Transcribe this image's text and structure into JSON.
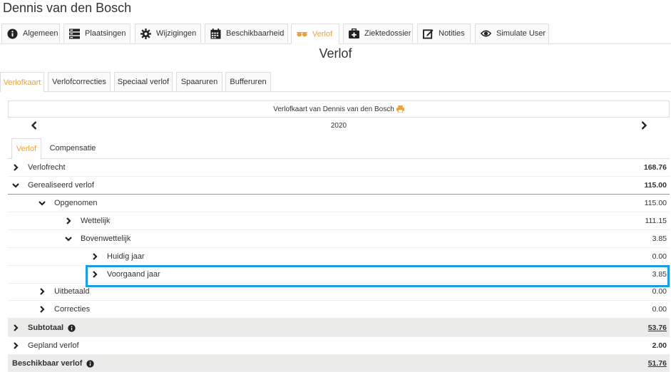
{
  "page": {
    "title": "Dennis van den Bosch",
    "section_title": "Verlof"
  },
  "main_tabs": [
    {
      "label": "Algemeen",
      "icon": "info-circle-icon"
    },
    {
      "label": "Plaatsingen",
      "icon": "server-icon"
    },
    {
      "label": "Wijzigingen",
      "icon": "gear-icon"
    },
    {
      "label": "Beschikbaarheid",
      "icon": "calendar-icon"
    },
    {
      "label": "Verlof",
      "icon": "sunglasses-icon"
    },
    {
      "label": "Ziektedossier",
      "icon": "medkit-icon"
    },
    {
      "label": "Notities",
      "icon": "edit-note-icon"
    },
    {
      "label": "Simulate User",
      "icon": "eye-icon"
    }
  ],
  "sub_tabs": [
    "Verlofkaart",
    "Verlofcorrecties",
    "Speciaal verlof",
    "Spaaruren",
    "Bufferuren"
  ],
  "card": {
    "header": "Verlofkaart van Dennis van den Bosch",
    "print_icon": "print-icon",
    "year": "2020"
  },
  "inner_tabs": [
    "Verlof",
    "Compensatie"
  ],
  "rows": [
    {
      "label": "Verlofrecht",
      "value": "168.76"
    },
    {
      "label": "Gerealiseerd verlof",
      "value": "115.00"
    },
    {
      "label": "Opgenomen",
      "value": "115.00"
    },
    {
      "label": "Wettelijk",
      "value": "111.15"
    },
    {
      "label": "Bovenwettelijk",
      "value": "3.85"
    },
    {
      "label": "Huidig jaar",
      "value": "0.00"
    },
    {
      "label": "Voorgaand jaar",
      "value": "3.85"
    },
    {
      "label": "Uitbetaald",
      "value": "0.00"
    },
    {
      "label": "Correcties",
      "value": "0.00"
    },
    {
      "label": "Subtotaal",
      "value": "53.76"
    },
    {
      "label": "Gepland verlof",
      "value": "2.00"
    },
    {
      "label": "Beschikbaar verlof",
      "value": "51.76"
    }
  ],
  "colors": {
    "accent": "#e8a33d",
    "highlight": "#1a9fdd",
    "grey_row": "#ebebea"
  }
}
